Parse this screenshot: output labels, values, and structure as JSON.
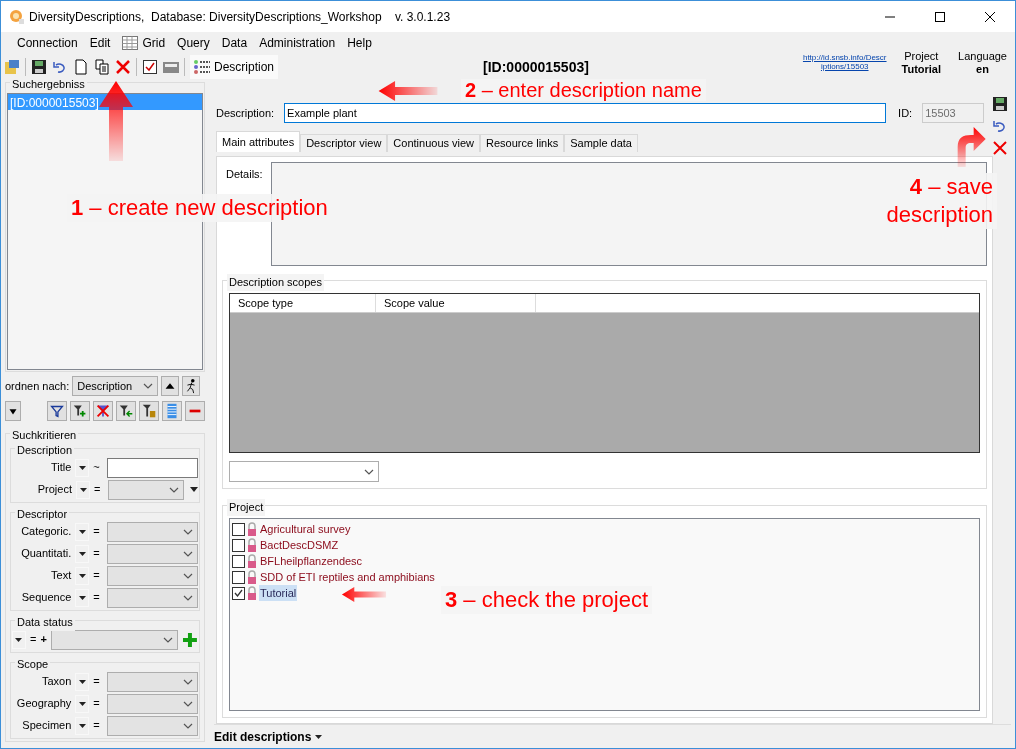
{
  "window": {
    "title": "DiversityDescriptions,  Database: DiversityDescriptions_Workshop    v. 3.0.1.23"
  },
  "menu": [
    {
      "label": "Connection",
      "kind": "plain"
    },
    {
      "label": "Edit",
      "kind": "plain"
    },
    {
      "label": "Grid",
      "kind": "icon"
    },
    {
      "label": "Query",
      "kind": "plain"
    },
    {
      "label": "Data",
      "kind": "plain"
    },
    {
      "label": "Administration",
      "kind": "plain"
    },
    {
      "label": "Help",
      "kind": "plain"
    }
  ],
  "toolbar": {
    "view_label": "Description"
  },
  "header": {
    "id": "[ID:0000015503]",
    "link_lines": [
      "http://id.snsb.info/Descr",
      "iptions/15503"
    ],
    "project_label": "Project",
    "project_value": "Tutorial",
    "language_label": "Language",
    "language_value": "en"
  },
  "results": {
    "title": "Suchergebniss",
    "items": [
      {
        "label": "[ID:0000015503]",
        "selected": true
      }
    ]
  },
  "sort": {
    "label": "ordnen nach:",
    "value": "Description"
  },
  "criteria": {
    "title": "Suchkritieren",
    "groups": [
      {
        "title": "Description",
        "rows": [
          {
            "kind": "text",
            "label": "Title",
            "op": "~"
          },
          {
            "kind": "select_extra",
            "label": "Project",
            "op": "="
          }
        ]
      },
      {
        "title": "Descriptor",
        "rows": [
          {
            "kind": "select",
            "label": "Categoric.",
            "op": "="
          },
          {
            "kind": "select",
            "label": "Quantitati.",
            "op": "="
          },
          {
            "kind": "select",
            "label": "Text",
            "op": "="
          },
          {
            "kind": "select",
            "label": "Sequence",
            "op": "="
          }
        ]
      },
      {
        "title": "Data status",
        "rows": [
          {
            "kind": "status",
            "op": "=",
            "plus": "+"
          }
        ]
      },
      {
        "title": "Scope",
        "rows": [
          {
            "kind": "select",
            "label": "Taxon",
            "op": "="
          },
          {
            "kind": "select",
            "label": "Geography",
            "op": "="
          },
          {
            "kind": "select",
            "label": "Specimen",
            "op": "="
          }
        ]
      }
    ]
  },
  "description": {
    "label": "Description:",
    "value": "Example plant",
    "id_label": "ID:",
    "id_value": "15503"
  },
  "tabs": [
    {
      "label": "Main attributes",
      "selected": true
    },
    {
      "label": "Descriptor view",
      "selected": false
    },
    {
      "label": "Continuous view",
      "selected": false
    },
    {
      "label": "Resource links",
      "selected": false
    },
    {
      "label": "Sample data",
      "selected": false
    }
  ],
  "details": {
    "label": "Details:"
  },
  "scopes": {
    "title": "Description scopes",
    "columns": [
      "Scope type",
      "Scope value"
    ]
  },
  "project": {
    "title": "Project",
    "items": [
      {
        "label": "Agricultural survey",
        "checked": false,
        "selected": false
      },
      {
        "label": "BactDescDSMZ",
        "checked": false,
        "selected": false
      },
      {
        "label": "BFLheilpflanzendesc",
        "checked": false,
        "selected": false
      },
      {
        "label": "SDD of ETI reptiles and amphibians",
        "checked": false,
        "selected": false
      },
      {
        "label": "Tutorial",
        "checked": true,
        "selected": true
      }
    ]
  },
  "status_bar": {
    "label": "Edit descriptions"
  },
  "annotations": [
    {
      "text": "**1** – create new description"
    },
    {
      "text": "**2** – enter description name"
    },
    {
      "text": "**3** – check the project"
    },
    {
      "text": "**4** – save description"
    }
  ]
}
